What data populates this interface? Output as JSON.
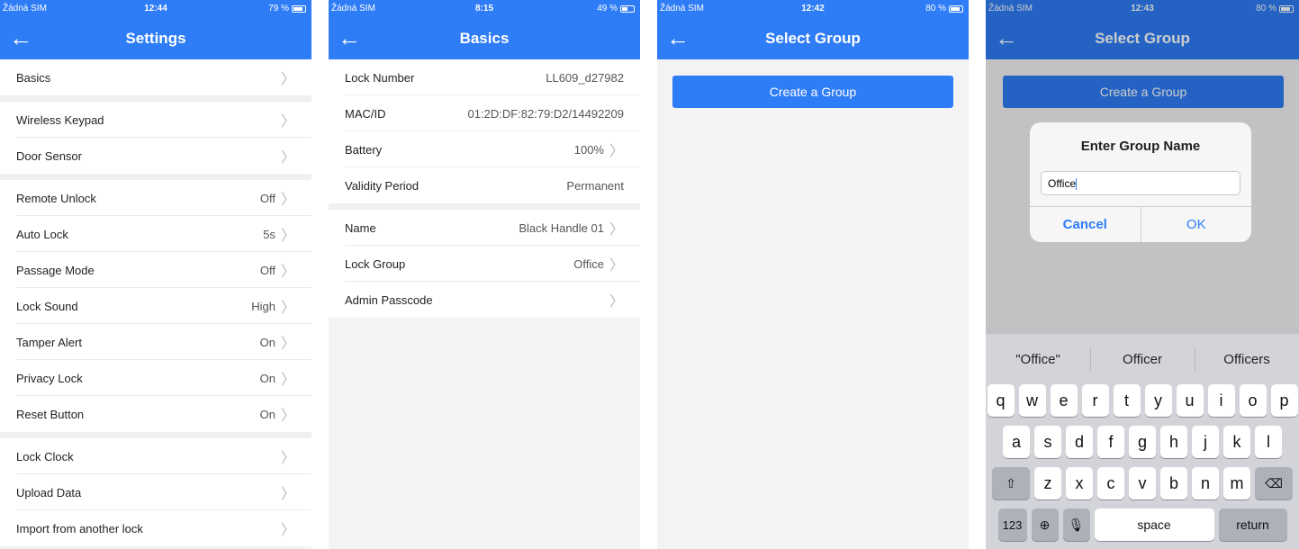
{
  "colors": {
    "accent": "#2e7cf6",
    "background": "#f3f3f5"
  },
  "screen1": {
    "status": {
      "carrier": "Žádná SIM",
      "time": "12:44",
      "battery": "79 %"
    },
    "nav": {
      "title": "Settings"
    },
    "groups": [
      [
        {
          "label": "Basics",
          "value": ""
        }
      ],
      [
        {
          "label": "Wireless Keypad",
          "value": ""
        },
        {
          "label": "Door Sensor",
          "value": ""
        }
      ],
      [
        {
          "label": "Remote Unlock",
          "value": "Off"
        },
        {
          "label": "Auto Lock",
          "value": "5s"
        },
        {
          "label": "Passage Mode",
          "value": "Off"
        },
        {
          "label": "Lock Sound",
          "value": "High"
        },
        {
          "label": "Tamper Alert",
          "value": "On"
        },
        {
          "label": "Privacy Lock",
          "value": "On"
        },
        {
          "label": "Reset Button",
          "value": "On"
        }
      ],
      [
        {
          "label": "Lock Clock",
          "value": ""
        },
        {
          "label": "Upload Data",
          "value": ""
        },
        {
          "label": "Import from another lock",
          "value": ""
        }
      ]
    ]
  },
  "screen2": {
    "status": {
      "carrier": "Žádná SIM",
      "time": "8:15",
      "battery": "49 %"
    },
    "nav": {
      "title": "Basics"
    },
    "rows": [
      {
        "label": "Lock Number",
        "value": "LL609_d27982"
      },
      {
        "label": "MAC/ID",
        "value": "01:2D:DF:82:79:D2/14492209"
      },
      {
        "label": "Battery",
        "value": "100%"
      },
      {
        "label": "Validity Period",
        "value": "Permanent"
      },
      {
        "label": "Name",
        "value": "Black Handle 01"
      },
      {
        "label": "Lock Group",
        "value": "Office"
      },
      {
        "label": "Admin Passcode",
        "value": ""
      }
    ]
  },
  "screen3": {
    "status": {
      "carrier": "Žádná SIM",
      "time": "12:42",
      "battery": "80 %"
    },
    "nav": {
      "title": "Select Group"
    },
    "create_button": "Create a Group"
  },
  "screen4": {
    "status": {
      "carrier": "Žádná SIM",
      "time": "12:43",
      "battery": "80 %"
    },
    "nav": {
      "title": "Select Group"
    },
    "create_button": "Create a Group",
    "dialog": {
      "title": "Enter Group Name",
      "input_value": "Office",
      "cancel": "Cancel",
      "ok": "OK"
    },
    "suggestions": [
      "\"Office\"",
      "Officer",
      "Officers"
    ],
    "keys": {
      "row1": [
        "q",
        "w",
        "e",
        "r",
        "t",
        "y",
        "u",
        "i",
        "o",
        "p"
      ],
      "row2": [
        "a",
        "s",
        "d",
        "f",
        "g",
        "h",
        "j",
        "k",
        "l"
      ],
      "row3": [
        "z",
        "x",
        "c",
        "v",
        "b",
        "n",
        "m"
      ],
      "numbers": "123",
      "space": "space",
      "return": "return"
    }
  }
}
